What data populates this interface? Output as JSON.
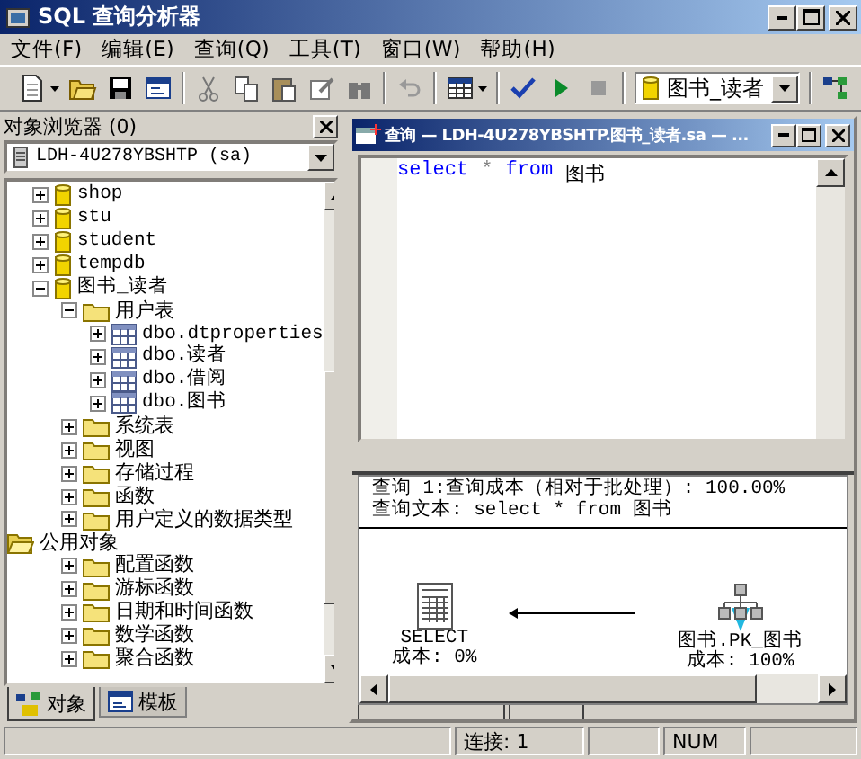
{
  "window": {
    "title": "SQL 查询分析器"
  },
  "menu": [
    "文件(F)",
    "编辑(E)",
    "查询(Q)",
    "工具(T)",
    "窗口(W)",
    "帮助(H)"
  ],
  "toolbar": {
    "database": "图书_读者"
  },
  "object_browser": {
    "title": "对象浏览器 (0)",
    "server": "LDH-4U278YBSHTP (sa)",
    "tree": [
      {
        "label": "shop",
        "kind": "database",
        "expanded": false
      },
      {
        "label": "stu",
        "kind": "database",
        "expanded": false
      },
      {
        "label": "student",
        "kind": "database",
        "expanded": false
      },
      {
        "label": "tempdb",
        "kind": "database",
        "expanded": false
      },
      {
        "label": "图书_读者",
        "kind": "database",
        "expanded": true,
        "children": [
          {
            "label": "用户表",
            "kind": "folder",
            "expanded": true,
            "children": [
              {
                "label": "dbo.dtproperties",
                "kind": "table",
                "expanded": false
              },
              {
                "label": "dbo.读者",
                "kind": "table",
                "expanded": false
              },
              {
                "label": "dbo.借阅",
                "kind": "table",
                "expanded": false
              },
              {
                "label": "dbo.图书",
                "kind": "table",
                "expanded": false
              }
            ]
          },
          {
            "label": "系统表",
            "kind": "folder",
            "expanded": false
          },
          {
            "label": "视图",
            "kind": "folder",
            "expanded": false
          },
          {
            "label": "存储过程",
            "kind": "folder",
            "expanded": false
          },
          {
            "label": "函数",
            "kind": "folder",
            "expanded": false
          },
          {
            "label": "用户定义的数据类型",
            "kind": "folder",
            "expanded": false
          }
        ]
      },
      {
        "label": "公用对象",
        "kind": "root-folder",
        "expanded": true,
        "children": [
          {
            "label": "配置函数",
            "kind": "folder",
            "expanded": false
          },
          {
            "label": "游标函数",
            "kind": "folder",
            "expanded": false
          },
          {
            "label": "日期和时间函数",
            "kind": "folder",
            "expanded": false
          },
          {
            "label": "数学函数",
            "kind": "folder",
            "expanded": false
          },
          {
            "label": "聚合函数",
            "kind": "folder",
            "expanded": false
          }
        ]
      }
    ],
    "tabs": [
      {
        "label": "对象",
        "selected": true
      },
      {
        "label": "模板",
        "selected": false
      }
    ]
  },
  "query_window": {
    "title": "查询 — LDH-4U278YBSHTP.图书_读者.sa — ...",
    "sql": [
      {
        "text": "select",
        "kind": "keyword"
      },
      {
        "text": "*",
        "kind": "operator"
      },
      {
        "text": "from",
        "kind": "keyword"
      },
      {
        "text": "图书",
        "kind": "identifier"
      }
    ],
    "results": {
      "lines": [
        "查询 1:查询成本（相对于批处理）: 100.00%",
        "查询文本: select * from 图书"
      ],
      "plan_nodes": [
        {
          "kind": "select",
          "label": "SELECT",
          "cost": "成本: 0%"
        },
        {
          "kind": "index-scan",
          "label": "图书.PK_图书",
          "cost": "成本: 100%"
        }
      ]
    }
  },
  "status_bar": [
    "连接: 1",
    "NUM"
  ]
}
